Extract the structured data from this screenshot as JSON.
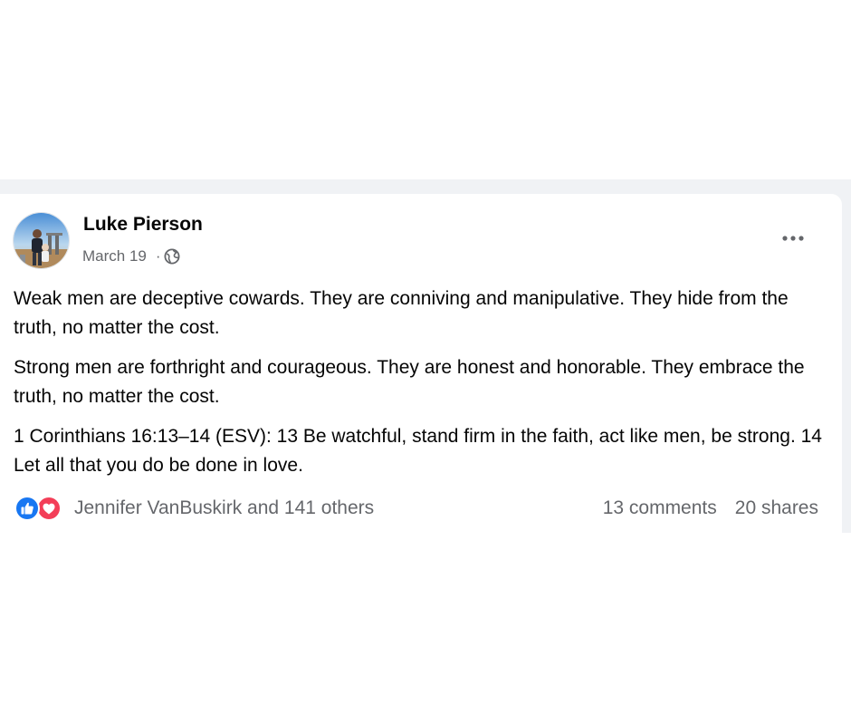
{
  "post": {
    "author": "Luke Pierson",
    "date": "March 19",
    "separator": "·",
    "audience_icon": "globe-icon",
    "more_icon": "more-options-icon",
    "paragraphs": [
      "Weak men are deceptive cowards. They are conniving and manipulative. They hide from the truth, no matter the cost.",
      "Strong men are forthright and courageous. They are honest and honorable. They embrace the truth, no matter the cost.",
      "1 Corinthians 16:13–14 (ESV): 13 Be watchful, stand firm in the faith, act like men, be strong. 14 Let all that you do be done in love."
    ],
    "reactions": {
      "icons": [
        "like-reaction-icon",
        "love-reaction-icon"
      ],
      "summary": "Jennifer VanBuskirk and 141 others"
    },
    "comments": "13 comments",
    "shares": "20 shares"
  },
  "colors": {
    "feed_background": "#f0f2f5",
    "card_background": "#ffffff",
    "primary_text": "#050505",
    "secondary_text": "#65676b",
    "like_blue": "#1877f2",
    "love_red": "#f33e58"
  }
}
